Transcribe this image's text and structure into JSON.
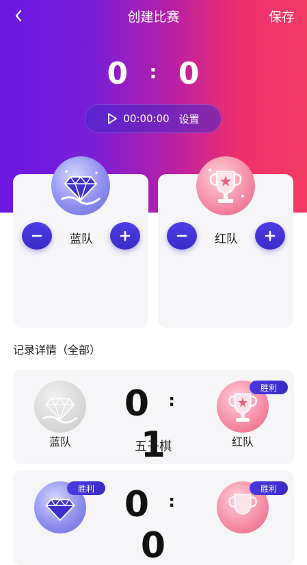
{
  "header": {
    "title": "创建比赛",
    "save_label": "保存",
    "score_left": "0",
    "score_sep": ":",
    "score_right": "0"
  },
  "timer": {
    "time": "00:00:00",
    "settings_label": "设置"
  },
  "teams": {
    "blue": {
      "name": "蓝队",
      "minus_label": "−",
      "plus_label": "+"
    },
    "red": {
      "name": "红队",
      "minus_label": "−",
      "plus_label": "+"
    }
  },
  "records": {
    "section_title": "记录详情（全部）",
    "items": [
      {
        "left_team": "蓝队",
        "right_team": "红队",
        "left_score": "0",
        "sep": ":",
        "right_score": "1",
        "game": "五子棋",
        "winner_tag": "胜利",
        "winner": "right"
      },
      {
        "left_score": "0",
        "sep": ":",
        "right_score": "0",
        "winner_tag": "胜利"
      }
    ]
  },
  "colors": {
    "gradient_start": "#6a17e0",
    "gradient_end": "#f23a63",
    "accent_button": "#3a2bc8",
    "card_bg": "#f6f6f8"
  },
  "icons": [
    "back-chevron-icon",
    "play-icon",
    "minus-icon",
    "plus-icon",
    "diamond-hand-icon",
    "trophy-icon"
  ]
}
